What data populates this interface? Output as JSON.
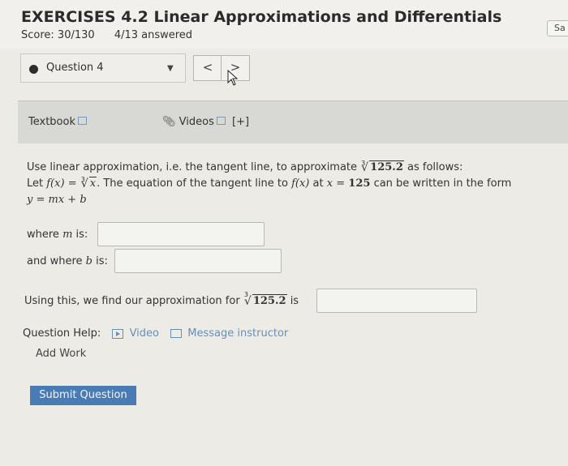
{
  "header": {
    "title": "EXERCISES 4.2 Linear Approximations and Differentials",
    "score": "Score: 30/130",
    "answered": "4/13 answered",
    "save_label": "Sa"
  },
  "question_nav": {
    "selected": "Question 4",
    "prev_symbol": "<",
    "next_symbol": ">"
  },
  "resources": {
    "textbook": "Textbook",
    "videos": "Videos",
    "expand": "[+]"
  },
  "problem": {
    "intro": "Use linear approximation, i.e. the tangent line, to approximate",
    "value": "125.2",
    "root_index": "3",
    "intro_end": "as follows:",
    "let_prefix": "Let",
    "f_x": "f(x)",
    "eq": "=",
    "root_var": "x",
    "tangent_text": ". The equation of the tangent line to",
    "at_text": "at",
    "x_var": "x",
    "x_eq": "=",
    "x_val": "125",
    "form_text": "can be written in the form",
    "line_form": "y = mx + b"
  },
  "answers": {
    "m_label_pre": "where",
    "m_var": "m",
    "m_label_post": "is:",
    "m_value": "",
    "b_label_pre": "and where",
    "b_var": "b",
    "b_label_post": "is:",
    "b_value": "",
    "approx_label": "Using this, we find our approximation for",
    "approx_is": "is",
    "approx_value": ""
  },
  "help": {
    "label": "Question Help:",
    "video": "Video",
    "message": "Message instructor",
    "add_work": "Add Work"
  },
  "submit_label": "Submit Question"
}
